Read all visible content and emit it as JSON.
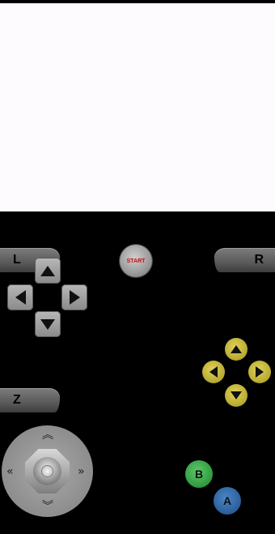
{
  "game_screen": {},
  "controller": {
    "shoulder": {
      "l_label": "L",
      "r_label": "R",
      "z_label": "Z"
    },
    "start_label": "START",
    "face": {
      "b_label": "B",
      "a_label": "A"
    },
    "colors": {
      "background": "#000000",
      "screen": "#fdfbfd",
      "start_text": "#c01010",
      "c_buttons": "#c8b93a",
      "b_button": "#2e9a3d",
      "a_button": "#2b5d9a"
    },
    "icons": {
      "dpad": [
        "up-arrow-icon",
        "down-arrow-icon",
        "left-arrow-icon",
        "right-arrow-icon"
      ],
      "c_buttons": [
        "c-up-icon",
        "c-down-icon",
        "c-left-icon",
        "c-right-icon"
      ],
      "stick": "analog-stick-icon"
    }
  }
}
